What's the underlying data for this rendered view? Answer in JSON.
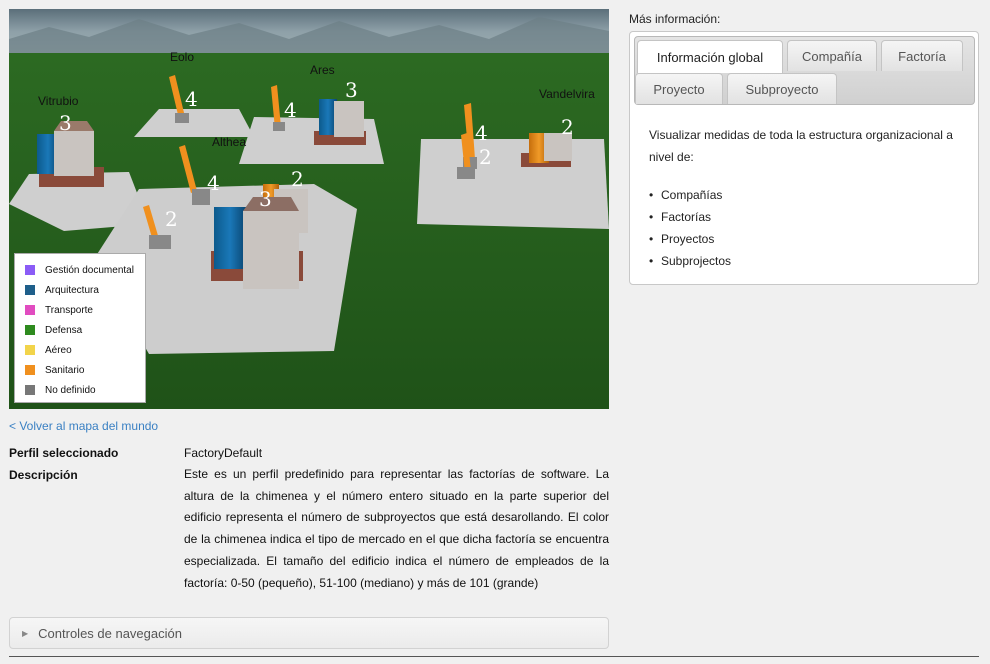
{
  "scene": {
    "factories": [
      {
        "name": "Vitrubio"
      },
      {
        "name": "Eolo"
      },
      {
        "name": "Ares"
      },
      {
        "name": "Althea"
      },
      {
        "name": "Vandelvira"
      }
    ],
    "numbers": [
      "3",
      "4",
      "3",
      "4",
      "4",
      "2",
      "3",
      "2",
      "4",
      "2",
      "2"
    ]
  },
  "legend": {
    "items": [
      {
        "label": "Gestión documental",
        "color": "#8b5cf6"
      },
      {
        "label": "Arquitectura",
        "color": "#1f5f8b"
      },
      {
        "label": "Transporte",
        "color": "#e14cc0"
      },
      {
        "label": "Defensa",
        "color": "#2e8b1e"
      },
      {
        "label": "Aéreo",
        "color": "#f2d44a"
      },
      {
        "label": "Sanitario",
        "color": "#f0901e"
      },
      {
        "label": "No definido",
        "color": "#777777"
      }
    ]
  },
  "back_link": "< Volver al mapa del mundo",
  "profile": {
    "label": "Perfil seleccionado",
    "value": "FactoryDefault"
  },
  "description": {
    "label": "Descripción",
    "value": "Este es un perfil predefinido para representar las factorías de software. La altura de la chimenea y el número entero situado en la parte superior del edificio representa el número de subproyectos que está desarollando. El color de la chimenea indica el tipo de mercado en el que dicha factoría se encuentra especializada. El tamaño del edificio indica el número de empleados de la factoría: 0-50 (pequeño), 51-100 (mediano) y más de 101 (grande)"
  },
  "nav_controls": "Controles de navegación",
  "more_info": {
    "title": "Más información:",
    "tabs": [
      "Información global",
      "Compañía",
      "Factoría",
      "Proyecto",
      "Subproyecto"
    ],
    "intro": "Visualizar medidas de toda la estructura organizacional a nivel de:",
    "items": [
      "Compañías",
      "Factorías",
      "Proyectos",
      "Subprojectos"
    ]
  }
}
